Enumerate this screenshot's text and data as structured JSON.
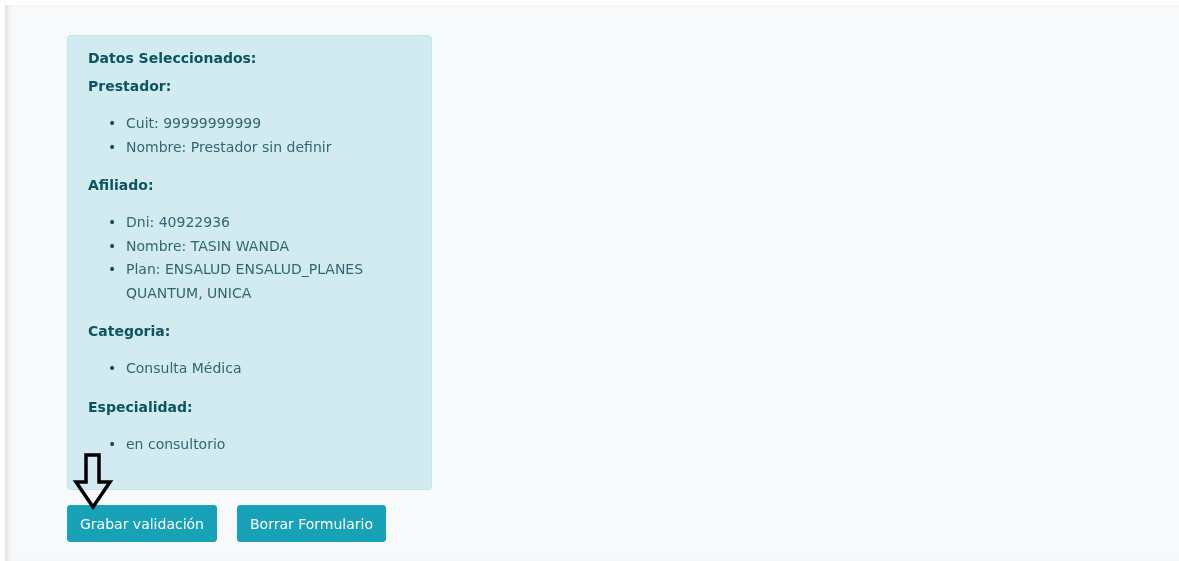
{
  "summary": {
    "title": "Datos Seleccionados:",
    "sections": [
      {
        "title": "Prestador:",
        "items": [
          {
            "marker": "•",
            "text": "Cuit: 99999999999"
          },
          {
            "marker": "•",
            "text": "Nombre: Prestador sin definir"
          }
        ]
      },
      {
        "title": "Afiliado:",
        "items": [
          {
            "marker": "•",
            "text": "Dni: 40922936"
          },
          {
            "marker": "•",
            "text": "Nombre: TASIN WANDA"
          },
          {
            "marker": "•",
            "text": "Plan: ENSALUD ENSALUD_PLANES QUANTUM, UNICA"
          }
        ]
      },
      {
        "title": "Categoria:",
        "items": [
          {
            "marker": "•",
            "text": "Consulta Médica"
          }
        ]
      },
      {
        "title": "Especialidad:",
        "items": [
          {
            "marker": "•",
            "text": "en consultorio"
          }
        ]
      }
    ]
  },
  "buttons": [
    "Grabar validación",
    "Borrar Formulario"
  ]
}
